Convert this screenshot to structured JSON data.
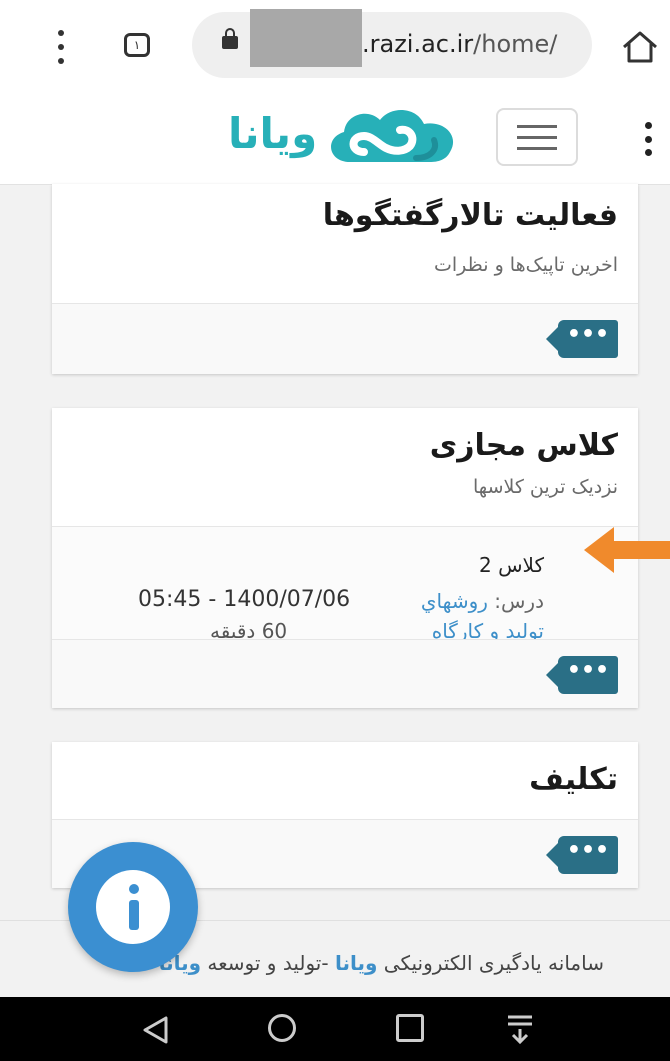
{
  "browser": {
    "tab_count": "١",
    "url_domain_suffix": ".razi.ac.ir",
    "url_path": "/home/"
  },
  "header": {
    "logo_text": "ویانا",
    "brand_color": "#27b0b8"
  },
  "cards": {
    "forum": {
      "title": "فعالیت تالارگفتگوها",
      "subtitle": "اخرین تاپیک‌ها و نظرات"
    },
    "virtual_class": {
      "title": "کلاس مجازی",
      "subtitle": "نزدیک ترین کلاسها",
      "item": {
        "name": "کلاس 2",
        "course_prefix": "درس:",
        "course_name_1": "روشهاي",
        "course_name_2": "توليد و كارگاه",
        "time": "05:45 - 1400/07/06",
        "duration": "60 دقیقه"
      }
    },
    "assignment": {
      "title": "تکلیف"
    },
    "more_label": "•••"
  },
  "footer": {
    "prefix": "سامانه یادگیری الکترونیکی",
    "link1": "ویانا",
    "middle": "-تولید و توسعه",
    "link2": "ویانا"
  },
  "colors": {
    "accent": "#3d8fc9",
    "more_button": "#2a6f86",
    "info_fab": "#3b8fd1",
    "arrow": "#f08a2c"
  }
}
